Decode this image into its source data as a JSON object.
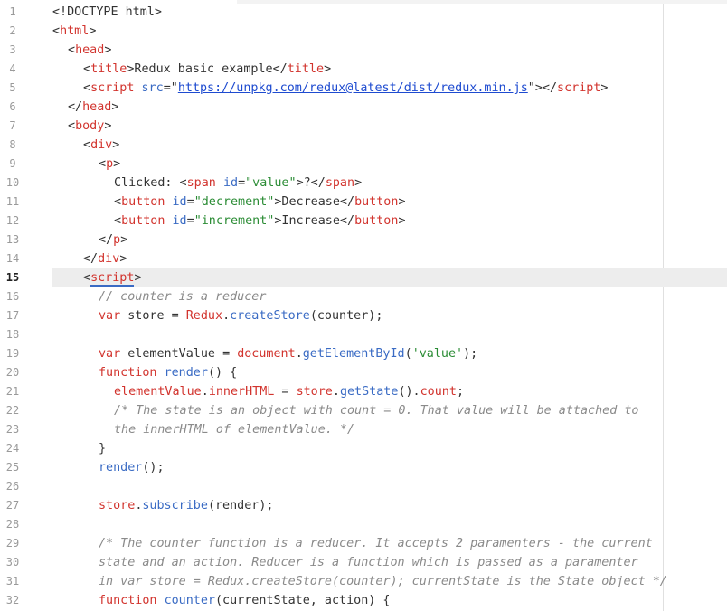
{
  "editor": {
    "active_line": "15",
    "lines": [
      {
        "num": "1",
        "parts": [
          [
            "pl",
            "<!DOCTYPE html>"
          ]
        ]
      },
      {
        "num": "2",
        "parts": [
          [
            "pl",
            "<"
          ],
          [
            "tag",
            "html"
          ],
          [
            "pl",
            ">"
          ]
        ]
      },
      {
        "num": "3",
        "parts": [
          [
            "pl",
            "<"
          ],
          [
            "tag",
            "head"
          ],
          [
            "pl",
            ">"
          ]
        ]
      },
      {
        "num": "4",
        "parts": [
          [
            "pl",
            "<"
          ],
          [
            "tag",
            "title"
          ],
          [
            "pl",
            ">Redux basic example</"
          ],
          [
            "tag",
            "title"
          ],
          [
            "pl",
            ">"
          ]
        ]
      },
      {
        "num": "5",
        "parts": [
          [
            "pl",
            "<"
          ],
          [
            "tag",
            "script"
          ],
          [
            "pl",
            " "
          ],
          [
            "attr",
            "src"
          ],
          [
            "pl",
            "=\""
          ],
          [
            "url",
            "https://unpkg.com/redux@latest/dist/redux.min.js"
          ],
          [
            "pl",
            "\"></"
          ],
          [
            "tag",
            "script"
          ],
          [
            "pl",
            ">"
          ]
        ]
      },
      {
        "num": "6",
        "parts": [
          [
            "pl",
            "</"
          ],
          [
            "tag",
            "head"
          ],
          [
            "pl",
            ">"
          ]
        ]
      },
      {
        "num": "7",
        "parts": [
          [
            "pl",
            "<"
          ],
          [
            "tag",
            "body"
          ],
          [
            "pl",
            ">"
          ]
        ]
      },
      {
        "num": "8",
        "parts": [
          [
            "pl",
            "<"
          ],
          [
            "tag",
            "div"
          ],
          [
            "pl",
            ">"
          ]
        ]
      },
      {
        "num": "9",
        "parts": [
          [
            "pl",
            "<"
          ],
          [
            "tag",
            "p"
          ],
          [
            "pl",
            ">"
          ]
        ]
      },
      {
        "num": "10",
        "parts": [
          [
            "pl",
            "Clicked: <"
          ],
          [
            "tag",
            "span"
          ],
          [
            "pl",
            " "
          ],
          [
            "attr",
            "id"
          ],
          [
            "pl",
            "="
          ],
          [
            "str",
            "\"value\""
          ],
          [
            "pl",
            ">?</"
          ],
          [
            "tag",
            "span"
          ],
          [
            "pl",
            ">"
          ]
        ]
      },
      {
        "num": "11",
        "parts": [
          [
            "pl",
            "<"
          ],
          [
            "tag",
            "button"
          ],
          [
            "pl",
            " "
          ],
          [
            "attr",
            "id"
          ],
          [
            "pl",
            "="
          ],
          [
            "str",
            "\"decrement\""
          ],
          [
            "pl",
            ">Decrease</"
          ],
          [
            "tag",
            "button"
          ],
          [
            "pl",
            ">"
          ]
        ]
      },
      {
        "num": "12",
        "parts": [
          [
            "pl",
            "<"
          ],
          [
            "tag",
            "button"
          ],
          [
            "pl",
            " "
          ],
          [
            "attr",
            "id"
          ],
          [
            "pl",
            "="
          ],
          [
            "str",
            "\"increment\""
          ],
          [
            "pl",
            ">Increase</"
          ],
          [
            "tag",
            "button"
          ],
          [
            "pl",
            ">"
          ]
        ]
      },
      {
        "num": "13",
        "parts": [
          [
            "pl",
            "</"
          ],
          [
            "tag",
            "p"
          ],
          [
            "pl",
            ">"
          ]
        ]
      },
      {
        "num": "14",
        "parts": [
          [
            "pl",
            "</"
          ],
          [
            "tag",
            "div"
          ],
          [
            "pl",
            ">"
          ]
        ]
      },
      {
        "num": "15",
        "parts": [
          [
            "pl",
            "<"
          ],
          [
            "tag",
            "script"
          ],
          [
            "pl",
            ">"
          ]
        ]
      },
      {
        "num": "16",
        "parts": [
          [
            "cm",
            "// counter is a reducer"
          ]
        ]
      },
      {
        "num": "17",
        "parts": [
          [
            "kw",
            "var"
          ],
          [
            "pl",
            " store "
          ],
          [
            "pl",
            "= "
          ],
          [
            "tag",
            "Redux"
          ],
          [
            "pl",
            "."
          ],
          [
            "fn",
            "createStore"
          ],
          [
            "pl",
            "(counter);"
          ]
        ]
      },
      {
        "num": "18",
        "parts": []
      },
      {
        "num": "19",
        "parts": [
          [
            "kw",
            "var"
          ],
          [
            "pl",
            " elementValue "
          ],
          [
            "pl",
            "= "
          ],
          [
            "tag",
            "document"
          ],
          [
            "pl",
            "."
          ],
          [
            "fn",
            "getElementById"
          ],
          [
            "pl",
            "("
          ],
          [
            "str",
            "'value'"
          ],
          [
            "pl",
            ");"
          ]
        ]
      },
      {
        "num": "20",
        "parts": [
          [
            "kw",
            "function"
          ],
          [
            "pl",
            " "
          ],
          [
            "fn",
            "render"
          ],
          [
            "pl",
            "() {"
          ]
        ]
      },
      {
        "num": "21",
        "parts": [
          [
            "tag",
            "elementValue"
          ],
          [
            "pl",
            "."
          ],
          [
            "tag",
            "innerHTML"
          ],
          [
            "pl",
            " = "
          ],
          [
            "tag",
            "store"
          ],
          [
            "pl",
            "."
          ],
          [
            "fn",
            "getState"
          ],
          [
            "pl",
            "()."
          ],
          [
            "tag",
            "count"
          ],
          [
            "pl",
            ";"
          ]
        ]
      },
      {
        "num": "22",
        "parts": [
          [
            "cm",
            "/* The state is an object with count = 0. That value will be attached to"
          ]
        ]
      },
      {
        "num": "23",
        "parts": [
          [
            "cm",
            "the innerHTML of elementValue. */"
          ]
        ]
      },
      {
        "num": "24",
        "parts": [
          [
            "pl",
            "}"
          ]
        ]
      },
      {
        "num": "25",
        "parts": [
          [
            "fn",
            "render"
          ],
          [
            "pl",
            "();"
          ]
        ]
      },
      {
        "num": "26",
        "parts": []
      },
      {
        "num": "27",
        "parts": [
          [
            "tag",
            "store"
          ],
          [
            "pl",
            "."
          ],
          [
            "fn",
            "subscribe"
          ],
          [
            "pl",
            "(render);"
          ]
        ]
      },
      {
        "num": "28",
        "parts": []
      },
      {
        "num": "29",
        "parts": [
          [
            "cm",
            "/* The counter function is a reducer. It accepts 2 paramenters - the current"
          ]
        ]
      },
      {
        "num": "30",
        "parts": [
          [
            "cm",
            "state and an action. Reducer is a function which is passed as a paramenter"
          ]
        ]
      },
      {
        "num": "31",
        "parts": [
          [
            "cm",
            "in var store = Redux.createStore(counter); currentState is the State object */"
          ]
        ]
      },
      {
        "num": "32",
        "parts": [
          [
            "kw",
            "function"
          ],
          [
            "pl",
            " "
          ],
          [
            "fn",
            "counter"
          ],
          [
            "pl",
            "(currentState, action) {"
          ]
        ]
      }
    ]
  }
}
